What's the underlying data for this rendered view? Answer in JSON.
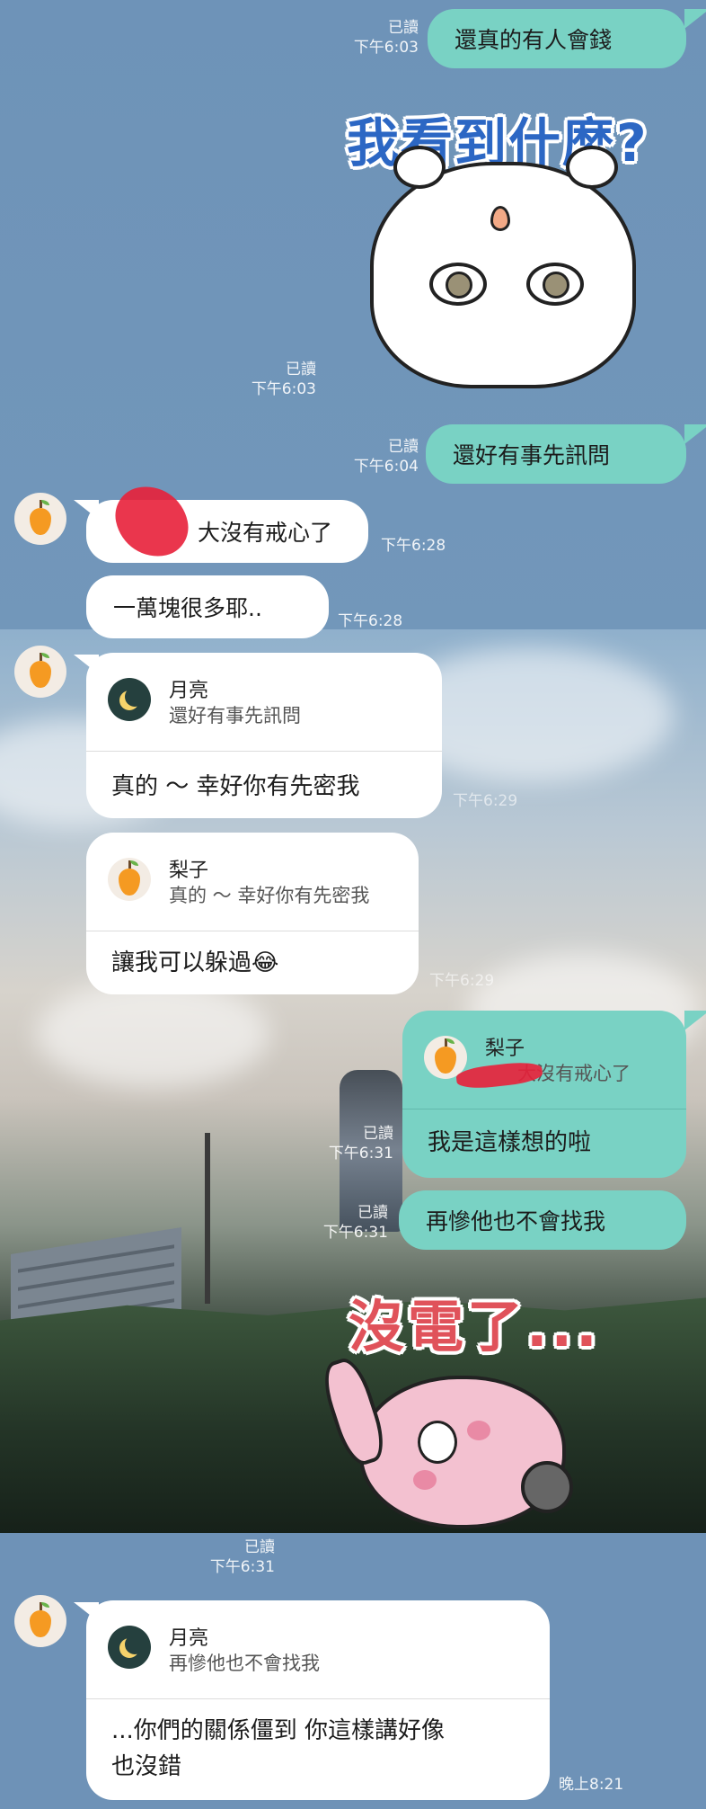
{
  "messages": [
    {
      "text": "還真的有人會錢",
      "read": "已讀",
      "time": "下午6:03"
    },
    {
      "sticker_text": "我看到什麼?",
      "read": "已讀",
      "time": "下午6:03"
    },
    {
      "text": "還好有事先訊問",
      "read": "已讀",
      "time": "下午6:04"
    },
    {
      "text": "大沒有戒心了",
      "time": "下午6:28"
    },
    {
      "text": "一萬塊很多耶..",
      "time": "下午6:28"
    },
    {
      "reply_to_name": "月亮",
      "reply_to_text": "還好有事先訊問",
      "text": "真的 ～ 幸好你有先密我",
      "time": "下午6:29"
    },
    {
      "reply_to_name": "梨子",
      "reply_to_text": "真的 ～ 幸好你有先密我",
      "text": "讓我可以躲過😂",
      "time": "下午6:29"
    },
    {
      "reply_to_name": "梨子",
      "reply_to_text": "大沒有戒心了",
      "text": "我是這樣想的啦",
      "read": "已讀",
      "time": "下午6:31"
    },
    {
      "text": "再慘他也不會找我",
      "read": "已讀",
      "time": "下午6:31"
    },
    {
      "sticker_text": "沒電了...",
      "read": "已讀",
      "time": "下午6:31"
    },
    {
      "reply_to_name": "月亮",
      "reply_to_text": "再慘他也不會找我",
      "text_line1": "...你們的關係僵到 你這樣講好像",
      "text_line2": "也沒錯",
      "time": "晚上8:21"
    }
  ],
  "colors": {
    "outgoing_bubble": "#79d2c4",
    "incoming_bubble": "#ffffff",
    "background": "#6f92b6"
  },
  "icons": {
    "contact_avatar": "pear-icon",
    "quote_moon": "moon-icon"
  }
}
